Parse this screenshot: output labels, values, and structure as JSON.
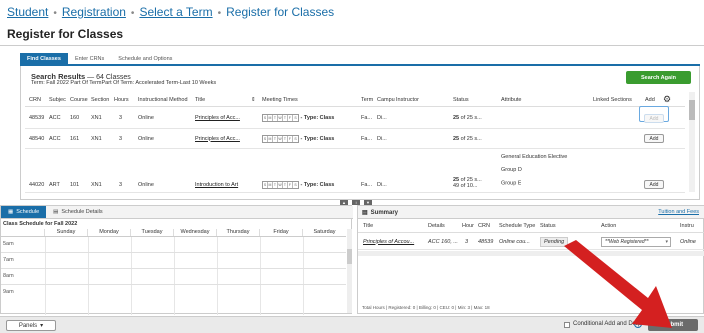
{
  "breadcrumb": {
    "items": [
      "Student",
      "Registration",
      "Select a Term"
    ],
    "current": "Register for Classes",
    "sep": "•"
  },
  "page_title": "Register for Classes",
  "tabs": [
    {
      "label": "Find Classes"
    },
    {
      "label": "Enter CRNs"
    },
    {
      "label": "Schedule and Options"
    }
  ],
  "results": {
    "title": "Search Results",
    "count_text": "— 64 Classes",
    "term_text": "Term: Fall 2022    Part Of TermPart Of Term: Accelerated Term-Last 10 Weeks",
    "search_again": "Search Again",
    "headers": [
      "CRN",
      "Subjec",
      "Course",
      "Section",
      "Hours",
      "Instructional Method",
      "Title",
      "Meeting Times",
      "Term",
      "Campu",
      "Instructor",
      "Status",
      "Attribute",
      "Linked Sections",
      "Add"
    ],
    "days": [
      "S",
      "M",
      "T",
      "W",
      "T",
      "F",
      "S"
    ],
    "type_text": "- Type: Class",
    "rows": [
      {
        "crn": "48539",
        "subject": "ACC",
        "course": "160",
        "section": "XN1",
        "hours": "3",
        "method": "Online",
        "title": "Principles of Acc...",
        "term": "Fa...",
        "campus": "Di...",
        "status_bold": "25",
        "status_rest": " of 25 s...",
        "attr1": "",
        "attr2": "",
        "attr3": "",
        "status2": "",
        "add": "Add"
      },
      {
        "crn": "48540",
        "subject": "ACC",
        "course": "161",
        "section": "XN1",
        "hours": "3",
        "method": "Online",
        "title": "Principles of Acc...",
        "term": "Fa...",
        "campus": "Di...",
        "status_bold": "25",
        "status_rest": " of 25 s...",
        "attr1": "",
        "attr2": "",
        "attr3": "",
        "status2": "",
        "add": "Add"
      },
      {
        "crn": "44020",
        "subject": "ART",
        "course": "101",
        "section": "XN1",
        "hours": "3",
        "method": "Online",
        "title": "Introduction to Art",
        "term": "Fa...",
        "campus": "Di...",
        "status_bold": "25",
        "status_rest": " of 25 s...",
        "attr1": "General Education Elective",
        "attr2": "Group D",
        "attr3": "Group E",
        "status2": "49 of 10...",
        "add": "Add"
      }
    ]
  },
  "schedule": {
    "tab_schedule": "Schedule",
    "tab_details": "Schedule Details",
    "title": "Class Schedule for Fall 2022",
    "days": [
      "Sunday",
      "Monday",
      "Tuesday",
      "Wednesday",
      "Thursday",
      "Friday",
      "Saturday"
    ],
    "times": [
      "5am",
      "7am",
      "8am",
      "9am"
    ]
  },
  "summary": {
    "title": "Summary",
    "tuition_link": "Tuition and Fees",
    "headers": [
      "Title",
      "Details",
      "Hour",
      "CRN",
      "Schedule Type",
      "Status",
      "Action",
      "Instru"
    ],
    "row": {
      "title": "Principles of Accou...",
      "details": "ACC 160, ...",
      "hours": "3",
      "crn": "48539",
      "schedule_type": "Online cou...",
      "status": "Pending",
      "action": "**Web Registered**",
      "instructor": "Online"
    },
    "totals": "Total Hours | Registered: 0 | Billing: 0 | CEU: 0 | Min: 3 | Max: 18"
  },
  "footer": {
    "panels": "Panels",
    "conditional": "Conditional Add and Drop",
    "info": "i",
    "submit": "Submit"
  },
  "colors": {
    "accent": "#1a6ea8",
    "search_again": "#3a9c2f",
    "arrow": "#d42020"
  }
}
